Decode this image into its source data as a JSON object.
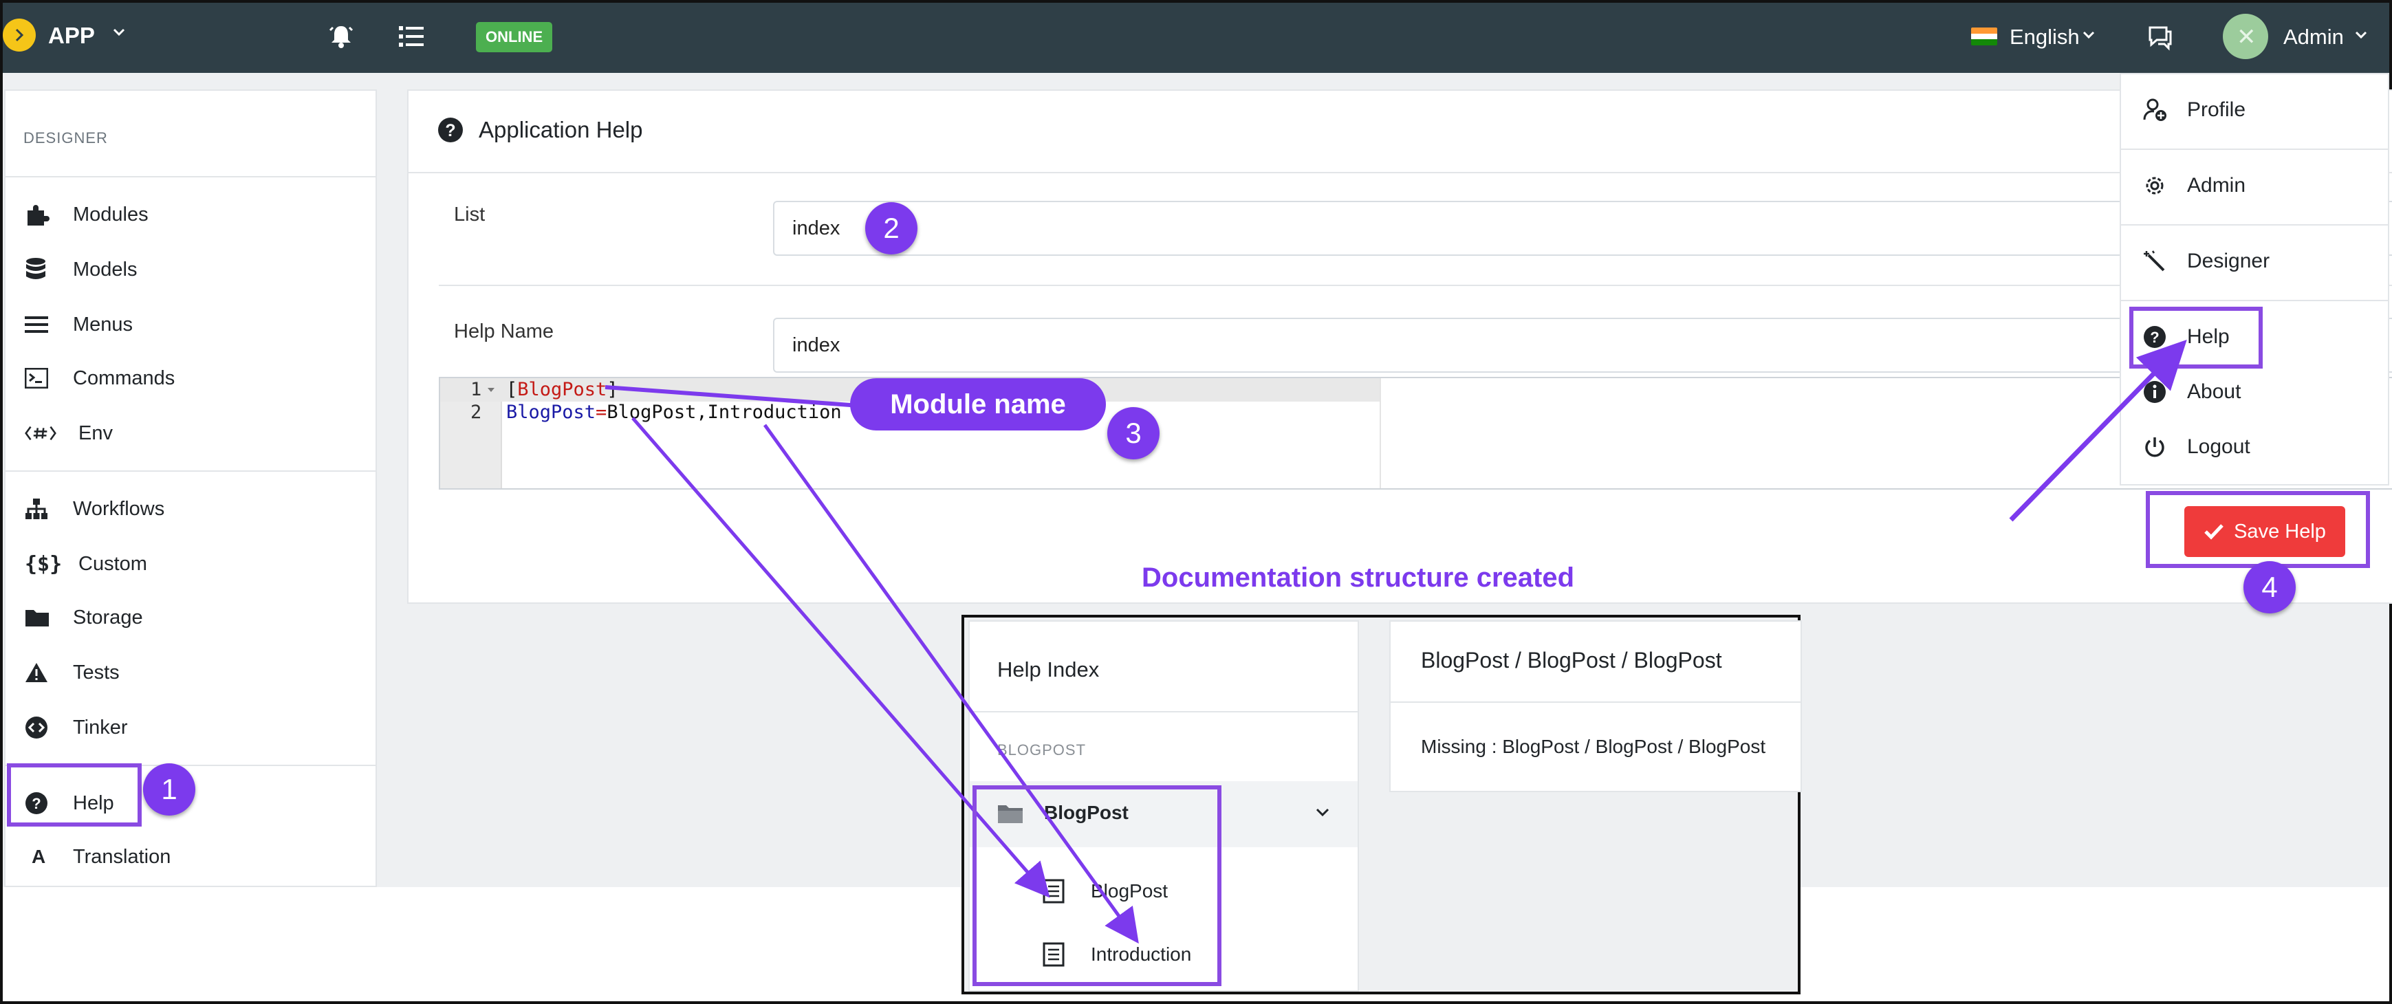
{
  "topbar": {
    "app_name": "APP",
    "status_badge": "ONLINE",
    "language": "English",
    "user": "Admin",
    "colors": {
      "bg": "#2f3f47",
      "logo": "#f5c518",
      "online": "#4caf50"
    }
  },
  "sidebar": {
    "header": "DESIGNER",
    "items": [
      {
        "label": "Modules",
        "icon": "puzzle-icon"
      },
      {
        "label": "Models",
        "icon": "database-icon"
      },
      {
        "label": "Menus",
        "icon": "menu-lines-icon"
      },
      {
        "label": "Commands",
        "icon": "terminal-icon"
      },
      {
        "label": "Env",
        "icon": "code-hash-icon"
      },
      {
        "label": "Workflows",
        "icon": "sitemap-icon"
      },
      {
        "label": "Custom",
        "icon": "curly-dollar-icon"
      },
      {
        "label": "Storage",
        "icon": "folder-icon"
      },
      {
        "label": "Tests",
        "icon": "warning-triangle-icon"
      },
      {
        "label": "Tinker",
        "icon": "code-circle-icon"
      },
      {
        "label": "Help",
        "icon": "question-circle-icon"
      },
      {
        "label": "Translation",
        "icon": "letter-a-icon"
      }
    ]
  },
  "help_card": {
    "title": "Application Help",
    "list_label": "List",
    "list_value": "index",
    "help_name_label": "Help Name",
    "help_name_value": "index",
    "editor": {
      "line_numbers": [
        "1",
        "2"
      ],
      "line1_open": "[",
      "line1_key": "BlogPost",
      "line1_close": "]",
      "line2_key": "BlogPost",
      "line2_eq": "=",
      "line2_value": "BlogPost,Introduction"
    }
  },
  "dropdown": {
    "items": [
      {
        "label": "Profile",
        "icon": "user-plus-icon"
      },
      {
        "label": "Admin",
        "icon": "gear-icon"
      },
      {
        "label": "Designer",
        "icon": "magic-wand-icon"
      },
      {
        "label": "Help",
        "icon": "question-circle-icon"
      },
      {
        "label": "About",
        "icon": "info-circle-icon"
      },
      {
        "label": "Logout",
        "icon": "power-icon"
      }
    ]
  },
  "save_button": {
    "label": "Save Help",
    "color": "#ef3b3b"
  },
  "annotations": {
    "step1": "1",
    "step2": "2",
    "step3": "3",
    "step4": "4",
    "module_name": "Module name",
    "caption": "Documentation structure created",
    "color": "#7c3aed"
  },
  "inset": {
    "title": "Help Index",
    "section": "BLOGPOST",
    "folder": "BlogPost",
    "docs": [
      "BlogPost",
      "Introduction"
    ],
    "breadcrumb": "BlogPost / BlogPost / BlogPost",
    "message": "Missing : BlogPost / BlogPost / BlogPost"
  }
}
